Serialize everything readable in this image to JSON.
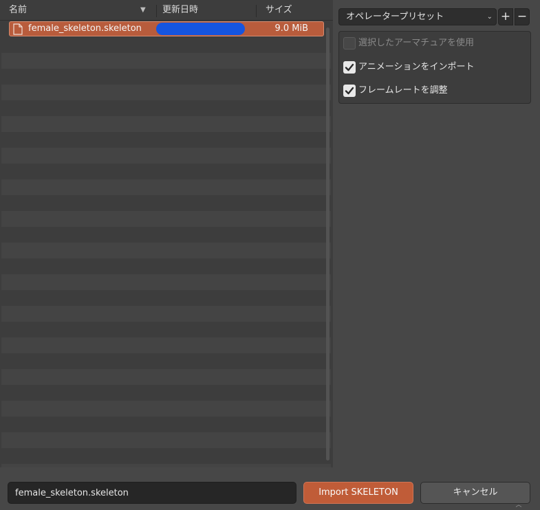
{
  "file_list": {
    "columns": {
      "name": "名前",
      "date": "更新日時",
      "size": "サイズ"
    },
    "sort_icon": "sort-descending-icon",
    "selected_file": {
      "name": "female_skeleton.skeleton",
      "size": "9.0 MiB",
      "icon": "file-icon"
    }
  },
  "operator": {
    "preset_label": "オペレータープリセット",
    "add_symbol": "+",
    "remove_symbol": "−",
    "options": [
      {
        "label": "選択したアーマチュアを使用",
        "checked": false,
        "enabled": false
      },
      {
        "label": "アニメーションをインポート",
        "checked": true,
        "enabled": true
      },
      {
        "label": "フレームレートを調整",
        "checked": true,
        "enabled": true
      }
    ]
  },
  "footer": {
    "filename_value": "female_skeleton.skeleton",
    "import_label": "Import SKELETON",
    "cancel_label": "キャンセル"
  },
  "colors": {
    "selection": "#b85c3c",
    "accent_button": "#c05c38",
    "redaction": "#1555e0"
  }
}
